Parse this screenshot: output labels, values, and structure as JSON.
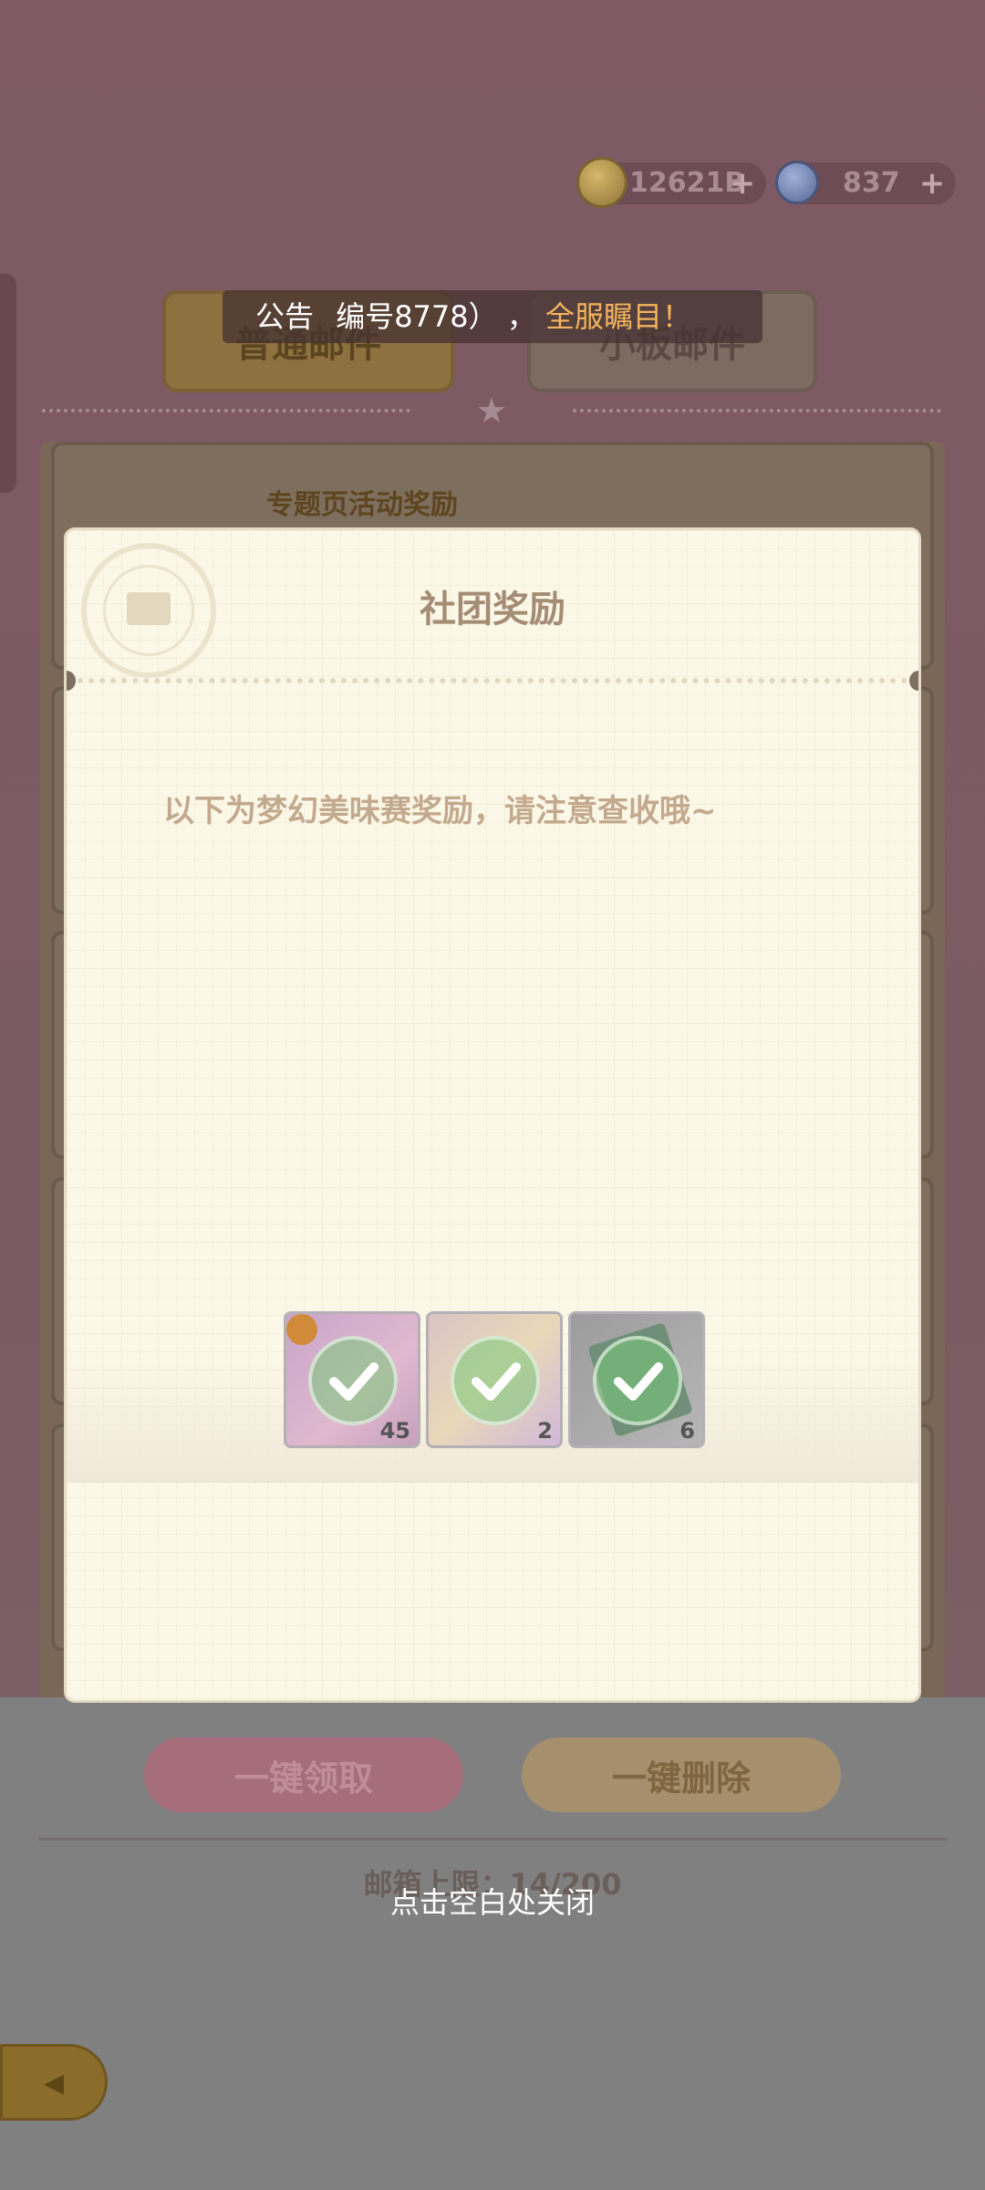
{
  "currency": {
    "coins": "12621B",
    "gems": "837"
  },
  "announcement": {
    "prefix": "公告",
    "text": "编号8778）",
    "comma": "，",
    "highlight": "全服瞩目！"
  },
  "tabs": {
    "normal": "普通邮件",
    "board": "小板邮件"
  },
  "list": {
    "first_title": "专题页活动奖励"
  },
  "modal": {
    "title": "社团奖励",
    "message": "以下为梦幻美味赛奖励，请注意查收哦~",
    "items": [
      {
        "count": "45",
        "icon": "frog-costume-icon"
      },
      {
        "count": "2",
        "icon": "ticket-icon"
      },
      {
        "count": "6",
        "icon": "card-icon"
      }
    ]
  },
  "buttons": {
    "claim_all": "一键领取",
    "delete_all": "一键删除"
  },
  "mailbox": {
    "limit": "邮箱上限：14/200"
  },
  "close_hint": "点击空白处关闭",
  "colors": {
    "accent_orange": "#f4b35c",
    "check_green": "#78c878"
  }
}
